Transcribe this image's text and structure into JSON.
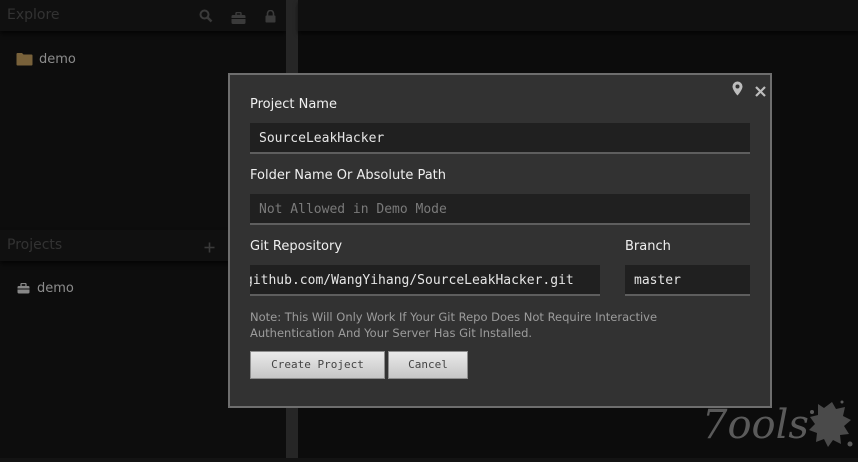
{
  "sidebar": {
    "explore_title": "Explore",
    "explore_icons": [
      "search-icon",
      "briefcase-icon",
      "lock-icon"
    ],
    "explore_items": [
      {
        "label": "demo",
        "icon": "folder-icon"
      }
    ],
    "projects_title": "Projects",
    "projects_add_icon": "plus-icon",
    "projects_items": [
      {
        "label": "demo",
        "icon": "briefcase-icon"
      }
    ]
  },
  "modal": {
    "icons": [
      "pin-icon",
      "close-icon"
    ],
    "project_name_label": "Project Name",
    "project_name_value": "SourceLeakHacker",
    "folder_label": "Folder Name Or Absolute Path",
    "folder_placeholder": "Not Allowed in Demo Mode",
    "git_label": "Git Repository",
    "git_value": "github.com/WangYihang/SourceLeakHacker.git",
    "branch_label": "Branch",
    "branch_value": "master",
    "note": "Note: This Will Only Work If Your Git Repo Does Not Require Interactive Authentication And Your Server Has Git Installed.",
    "create_button": "Create Project",
    "cancel_button": "Cancel"
  },
  "watermark": {
    "text": "7ools"
  },
  "colors": {
    "background": "#131313",
    "modal_bg": "#323232",
    "field_bg": "#202020",
    "folder": "#b8955a"
  }
}
